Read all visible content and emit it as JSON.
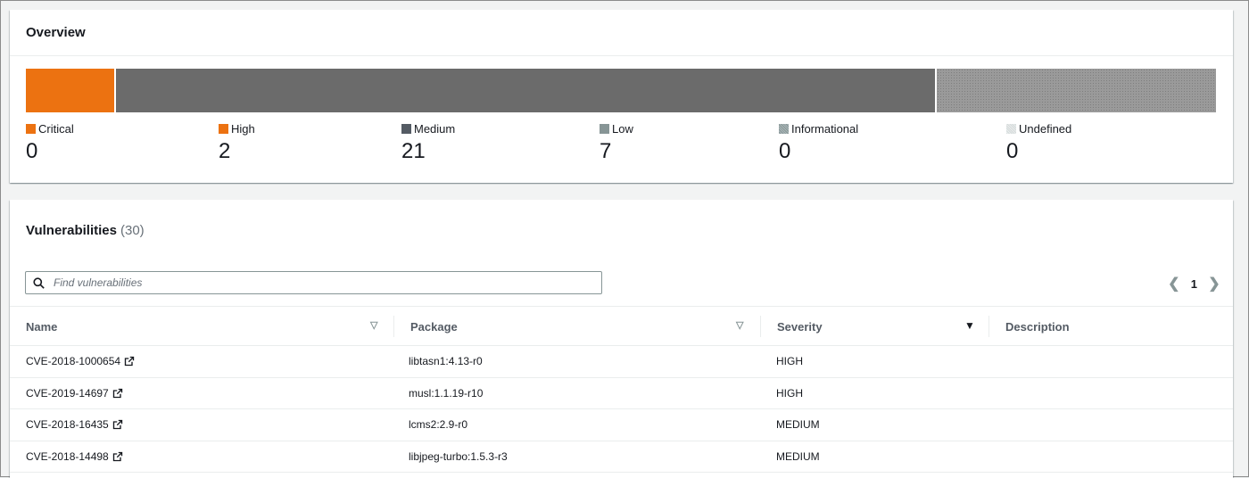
{
  "overview": {
    "title": "Overview",
    "severities": [
      {
        "label": "Critical",
        "count": "0",
        "color": "#ec7211"
      },
      {
        "label": "High",
        "count": "2",
        "color": "#ec7211"
      },
      {
        "label": "Medium",
        "count": "21",
        "color": "#545b64"
      },
      {
        "label": "Low",
        "count": "7",
        "color": "#879596"
      },
      {
        "label": "Informational",
        "count": "0",
        "color": "#aab7b8"
      },
      {
        "label": "Undefined",
        "count": "0",
        "color": "#d5dbdb"
      }
    ]
  },
  "vulnerabilities": {
    "title": "Vulnerabilities",
    "count": "(30)",
    "search_placeholder": "Find vulnerabilities",
    "page": "1",
    "columns": {
      "name": "Name",
      "package": "Package",
      "severity": "Severity",
      "description": "Description"
    },
    "rows": [
      {
        "name": "CVE-2018-1000654",
        "package": "libtasn1:4.13-r0",
        "severity": "HIGH",
        "description": ""
      },
      {
        "name": "CVE-2019-14697",
        "package": "musl:1.1.19-r10",
        "severity": "HIGH",
        "description": ""
      },
      {
        "name": "CVE-2018-16435",
        "package": "lcms2:2.9-r0",
        "severity": "MEDIUM",
        "description": ""
      },
      {
        "name": "CVE-2018-14498",
        "package": "libjpeg-turbo:1.5.3-r3",
        "severity": "MEDIUM",
        "description": ""
      }
    ]
  }
}
